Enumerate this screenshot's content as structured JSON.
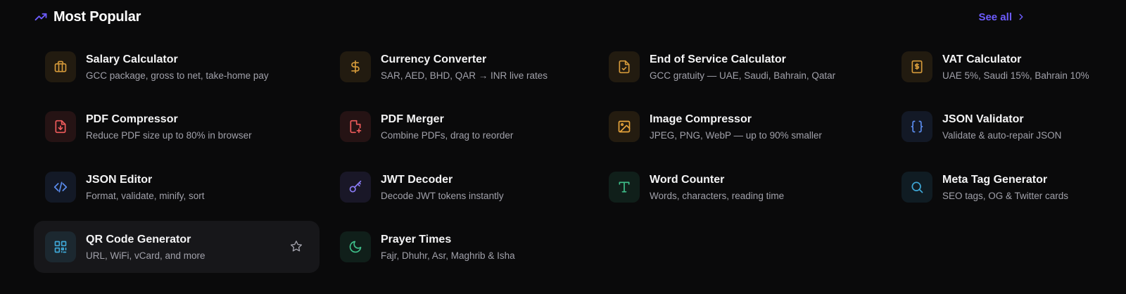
{
  "section": {
    "title": "Most Popular",
    "see_all": "See all",
    "accent": "#6d5cff"
  },
  "tools": [
    {
      "title": "Salary Calculator",
      "desc": "GCC package, gross to net, take-home pay",
      "icon": "briefcase-icon",
      "color": "#d59a3a"
    },
    {
      "title": "Currency Converter",
      "desc": "SAR, AED, BHD, QAR → INR live rates",
      "icon": "dollar-icon",
      "color": "#d59a3a"
    },
    {
      "title": "End of Service Calculator",
      "desc": "GCC gratuity — UAE, Saudi, Bahrain, Qatar",
      "icon": "file-check-icon",
      "color": "#d59a3a"
    },
    {
      "title": "VAT Calculator",
      "desc": "UAE 5%, Saudi 15%, Bahrain 10%",
      "icon": "receipt-icon",
      "color": "#d59a3a"
    },
    {
      "title": "PDF Compressor",
      "desc": "Reduce PDF size up to 80% in browser",
      "icon": "file-download-icon",
      "color": "#ef5b5b"
    },
    {
      "title": "PDF Merger",
      "desc": "Combine PDFs, drag to reorder",
      "icon": "file-plus-icon",
      "color": "#ef5b5b"
    },
    {
      "title": "Image Compressor",
      "desc": "JPEG, PNG, WebP — up to 90% smaller",
      "icon": "image-icon",
      "color": "#e8a53c"
    },
    {
      "title": "JSON Validator",
      "desc": "Validate & auto-repair JSON",
      "icon": "braces-icon",
      "color": "#5b8def"
    },
    {
      "title": "JSON Editor",
      "desc": "Format, validate, minify, sort",
      "icon": "code-icon",
      "color": "#5b8def"
    },
    {
      "title": "JWT Decoder",
      "desc": "Decode JWT tokens instantly",
      "icon": "key-icon",
      "color": "#8b7cf6"
    },
    {
      "title": "Word Counter",
      "desc": "Words, characters, reading time",
      "icon": "text-icon",
      "color": "#3fbf8a"
    },
    {
      "title": "Meta Tag Generator",
      "desc": "SEO tags, OG & Twitter cards",
      "icon": "search-icon",
      "color": "#3fa8d8"
    },
    {
      "title": "QR Code Generator",
      "desc": "URL, WiFi, vCard, and more",
      "icon": "qr-code-icon",
      "color": "#3fa8d8"
    },
    {
      "title": "Prayer Times",
      "desc": "Fajr, Dhuhr, Asr, Maghrib & Isha",
      "icon": "moon-icon",
      "color": "#3fbf8a"
    }
  ]
}
